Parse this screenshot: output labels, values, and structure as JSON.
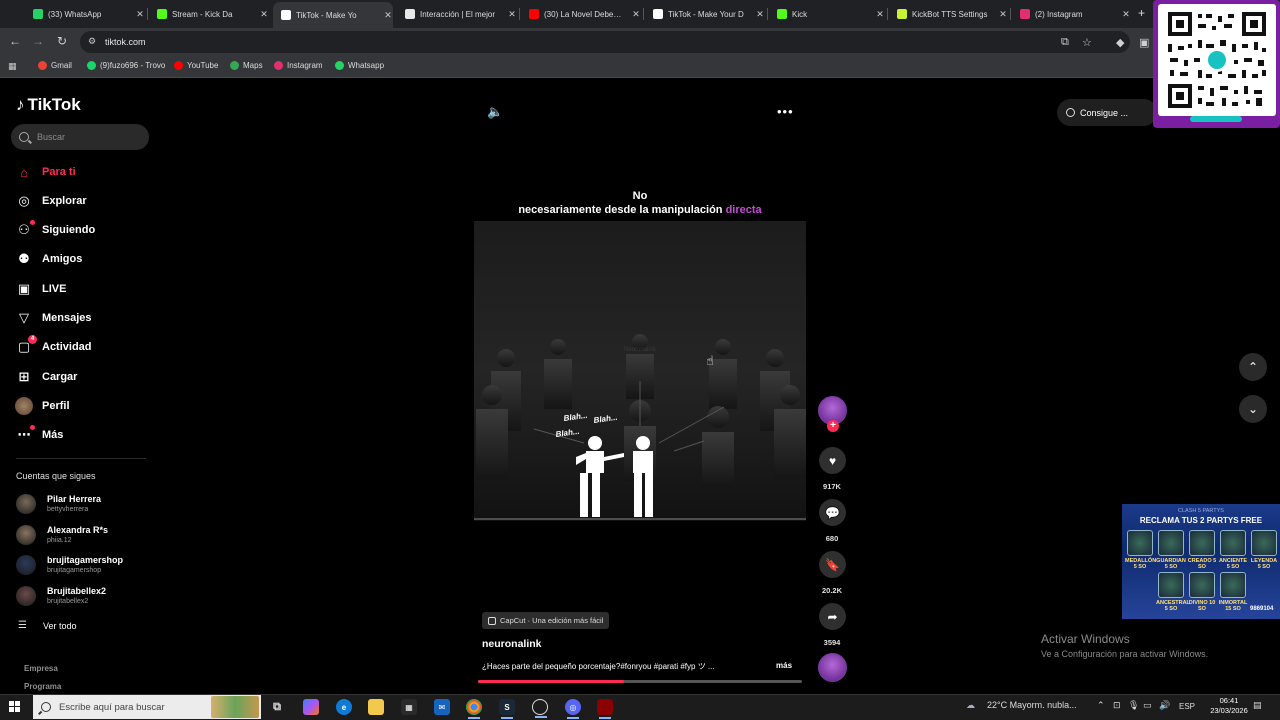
{
  "browser": {
    "tabs": [
      {
        "title": "(33) WhatsApp",
        "favicon_color": "#25d366",
        "active": false
      },
      {
        "title": "Stream - Kick Da",
        "favicon_color": "#53fc18",
        "active": false
      },
      {
        "title": "TikTok - Make Yo",
        "favicon_color": "#ffffff",
        "active": true
      },
      {
        "title": "Interacción | El mejor",
        "favicon_color": "#e8e8e8",
        "active": false
      },
      {
        "title": "(30) La Novel Debes C",
        "favicon_color": "#ff0000",
        "active": false
      },
      {
        "title": "TikTok - Make Your D",
        "favicon_color": "#ffffff",
        "active": false
      },
      {
        "title": "Kick",
        "favicon_color": "#53fc18",
        "active": false
      },
      {
        "title": "KickBot TTS Settings",
        "favicon_color": "#c6f432",
        "active": false
      },
      {
        "title": "(2) Instagram",
        "favicon_color": "#e1306c",
        "active": false
      }
    ],
    "url": "tiktok.com",
    "bookmarks": [
      {
        "label": "Gmail",
        "color": "#ea4335"
      },
      {
        "label": "(9)fuzo696 - Trovo",
        "color": "#19d66b"
      },
      {
        "label": "YouTube",
        "color": "#ff0000"
      },
      {
        "label": "Maps",
        "color": "#34a853"
      },
      {
        "label": "Instagram",
        "color": "#e1306c"
      },
      {
        "label": "Whatsapp",
        "color": "#25d366"
      }
    ]
  },
  "tiktok": {
    "logo": "TikTok",
    "search_placeholder": "Buscar",
    "nav": [
      {
        "label": "Para ti",
        "icon": "home-icon",
        "active": true
      },
      {
        "label": "Explorar",
        "icon": "compass-icon",
        "active": false
      },
      {
        "label": "Siguiendo",
        "icon": "following-icon",
        "active": false
      },
      {
        "label": "Amigos",
        "icon": "friends-icon",
        "active": false
      },
      {
        "label": "LIVE",
        "icon": "live-icon",
        "active": false
      },
      {
        "label": "Mensajes",
        "icon": "messages-icon",
        "active": false
      },
      {
        "label": "Actividad",
        "icon": "activity-icon",
        "active": false,
        "badge": "4"
      },
      {
        "label": "Cargar",
        "icon": "upload-icon",
        "active": false
      },
      {
        "label": "Perfil",
        "icon": "profile-avatar",
        "active": false
      },
      {
        "label": "Más",
        "icon": "more-icon",
        "active": false
      }
    ],
    "following_title": "Cuentas que sigues",
    "following": [
      {
        "name": "Pilar Herrera",
        "user": "bettyvherrera",
        "color": "#7a6a5a"
      },
      {
        "name": "Alexandra R*s",
        "user": "phiia.12",
        "color": "#8a7360"
      },
      {
        "name": "brujitagamershop",
        "user": "brujitagamershop",
        "color": "#2a3a5a"
      },
      {
        "name": "Brujitabellex2",
        "user": "brujitabellex2",
        "color": "#6a4a4a"
      }
    ],
    "see_all": "Ver todo",
    "footer_links": [
      "Empresa",
      "Programa"
    ],
    "get_app": "Consigue ...",
    "video": {
      "caption_line1": "No",
      "caption_line2_plain": "necesariamente desde la manipulación ",
      "caption_line2_highlight": "directa",
      "speech": [
        "Blah...",
        "Blah...",
        "Blah..."
      ],
      "watermark": "Neuronalink",
      "capcut_label": "CapCut · Una edición más fácil",
      "author": "neuronalink",
      "description": "¿Haces parte del pequeño porcentaje?#fonryou #parati #fyp ツ ...",
      "more_label": "más",
      "progress": 0.45,
      "likes": "917K",
      "comments": "680",
      "saves": "20.2K",
      "shares": "3594"
    }
  },
  "overlays": {
    "promo_title": "RECLAMA TUS 2 PARTYS FREE",
    "promo_top": "CLASH 5 PARTYS",
    "promo_cards": [
      "MEDALLÓN 5 SO",
      "GUARDIAN 5 SO",
      "CREADO 5 SO",
      "ANCIENTE 5 SO",
      "LEYENDA 5 SO",
      "ANCESTRAL 5 SO",
      "DIVINO 10 SO",
      "INMORTAL 15 SO"
    ],
    "promo_code": "9869104",
    "activate_title": "Activar Windows",
    "activate_sub": "Ve a Configuración para activar Windows."
  },
  "taskbar": {
    "search_placeholder": "Escribe aquí para buscar",
    "weather": "22°C  Mayorm. nubla...",
    "lang": "ESP",
    "time": "06:41",
    "date": "23/03/2026"
  }
}
